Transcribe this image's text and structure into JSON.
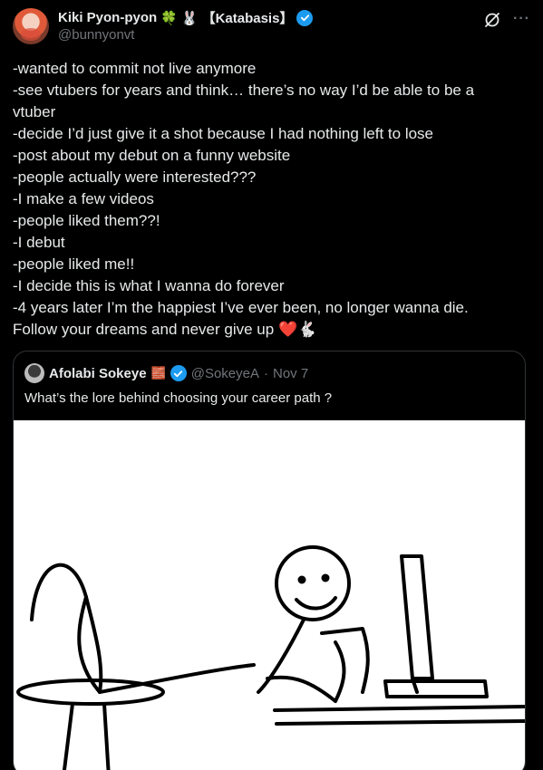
{
  "author": {
    "name": "Kiki Pyon-pyon",
    "emoji_clover": "🍀",
    "emoji_bunny": "🐰",
    "tag": "【Katabasis】",
    "handle": "@bunnyonvt"
  },
  "icons": {
    "verified": "verified-badge-icon",
    "grok": "grok-icon",
    "more": "more-options-icon"
  },
  "more_glyph": "···",
  "body_lines": [
    "-wanted to commit not live anymore",
    "-see vtubers for years and think… there’s no way I’d be able to be a",
    "vtuber",
    "-decide I’d just give it a shot because I had nothing left to lose",
    "-post about my debut on a funny website",
    "-people actually were interested???",
    "-I make a few videos",
    "-people liked them??!",
    "-I debut",
    "-people liked me!!",
    "-I decide this is what I wanna do forever",
    "-4 years later I’m the happiest I’ve ever been, no longer wanna die.",
    "Follow your dreams and never give up"
  ],
  "body_end_emoji": {
    "heart": "❤️",
    "rabbit": "🐇"
  },
  "quote": {
    "name": "Afolabi Sokeye",
    "brick_emoji": "🧱",
    "handle": "@SokeyeA",
    "separator": "·",
    "date": "Nov 7",
    "text": "What’s the lore behind choosing your career path ?"
  },
  "colors": {
    "background": "#000000",
    "text": "#e7e9ea",
    "muted": "#71767b",
    "verified": "#1d9bf0",
    "border": "#2f3336"
  }
}
